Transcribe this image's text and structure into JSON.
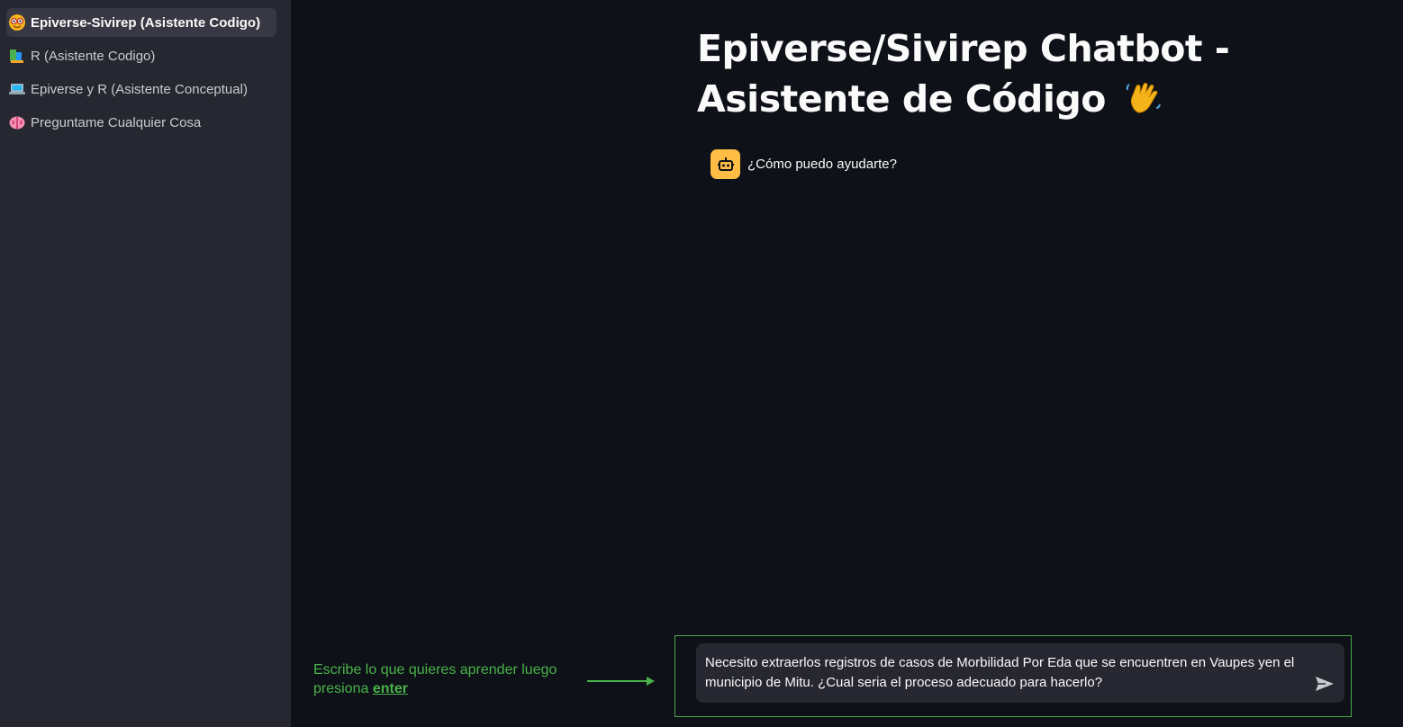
{
  "sidebar": {
    "items": [
      {
        "label": "Epiverse-Sivirep (Asistente Codigo)",
        "icon": "face-with-glasses-icon",
        "active": true
      },
      {
        "label": "R (Asistente Codigo)",
        "icon": "books-icon",
        "active": false
      },
      {
        "label": "Epiverse y R (Asistente Conceptual)",
        "icon": "laptop-icon",
        "active": false
      },
      {
        "label": "Preguntame Cualquier Cosa",
        "icon": "brain-icon",
        "active": false
      }
    ]
  },
  "main": {
    "title": "Epiverse/Sivirep Chatbot - Asistente de Código",
    "title_emoji": "waving-hand-icon",
    "messages": [
      {
        "role": "assistant",
        "avatar": "robot-icon",
        "text": "¿Cómo puedo ayudarte?"
      }
    ]
  },
  "hint": {
    "text": "Escribe lo que quieres aprender luego presiona",
    "key": "enter"
  },
  "chat_input": {
    "value": "Necesito extraerlos  registros de casos de Morbilidad Por Eda que se encuentren en Vaupes yen el municipio de Mitu. ¿Cual seria el proceso adecuado para hacerlo?"
  },
  "colors": {
    "background": "#0e1117",
    "sidebar": "#262730",
    "accent_green": "#4ab34a",
    "avatar": "#ffbd45"
  }
}
